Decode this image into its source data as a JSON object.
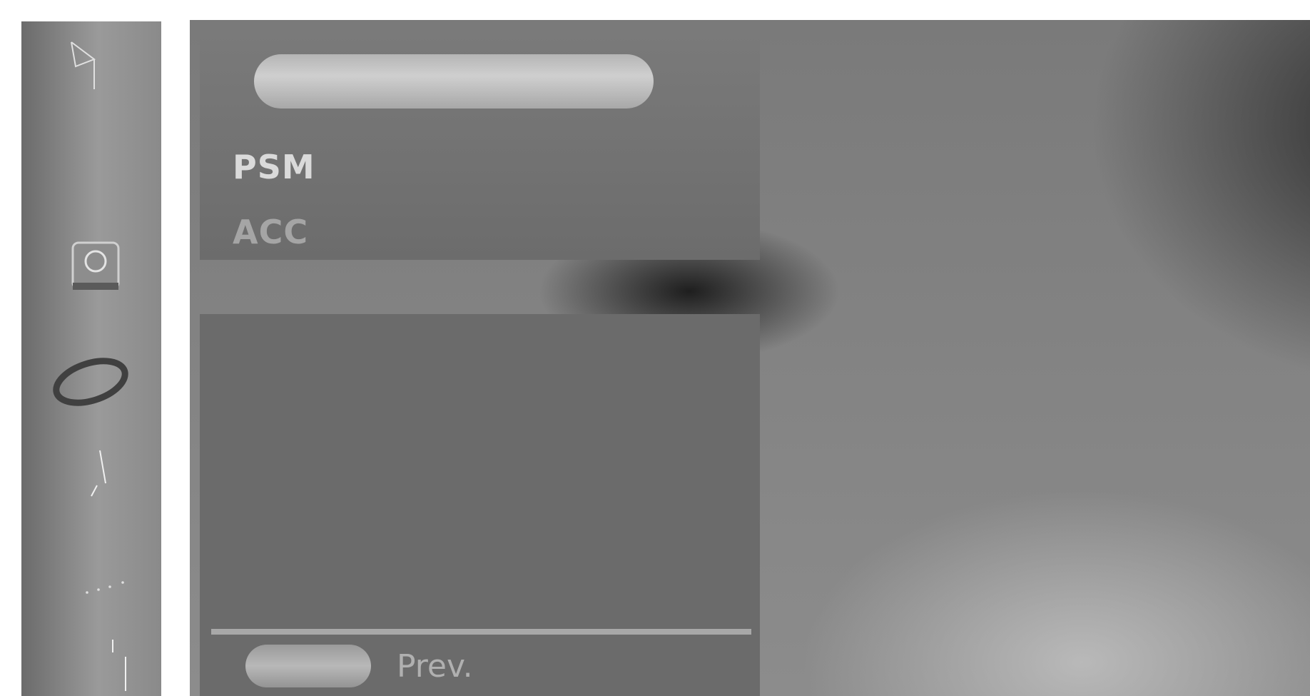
{
  "side_icons": [
    {
      "name": "picture-icon"
    },
    {
      "name": "sound-icon"
    },
    {
      "name": "time-icon"
    },
    {
      "name": "option-icon"
    },
    {
      "name": "screen-icon"
    },
    {
      "name": "pip-icon"
    }
  ],
  "menu": {
    "title": "",
    "items": [
      {
        "label": "PSM",
        "state": "selected"
      },
      {
        "label": "ACC",
        "state": "normal"
      }
    ]
  },
  "footer": {
    "prev_label": "Prev."
  },
  "colors": {
    "panel": "#6b6b6b",
    "selected_text": "#dadada",
    "normal_text": "#a5a5a5"
  }
}
